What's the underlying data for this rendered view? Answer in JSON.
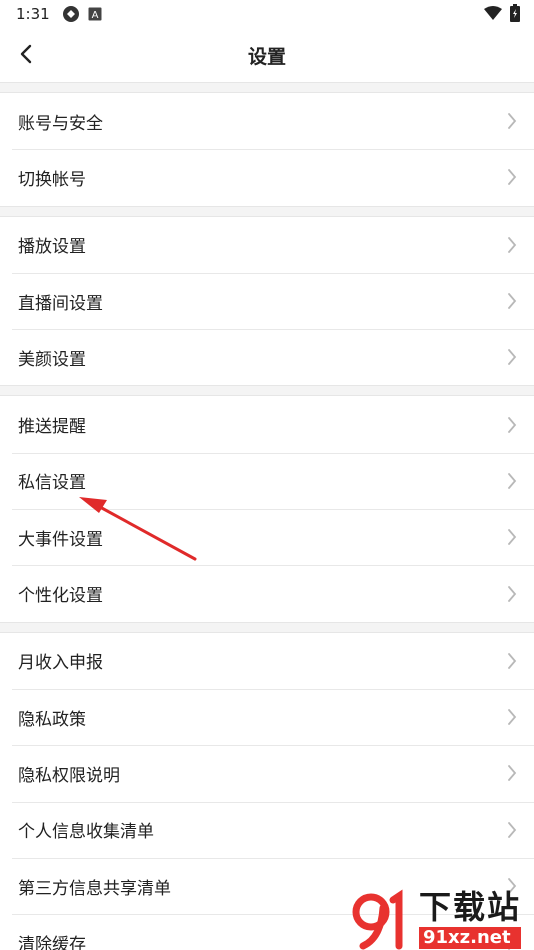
{
  "status_bar": {
    "time": "1:31",
    "icons_left": [
      "sync-icon",
      "a-badge-icon"
    ],
    "icons_right": [
      "wifi-icon",
      "battery-icon"
    ]
  },
  "nav": {
    "title": "设置",
    "back_icon": "chevron-left-icon"
  },
  "groups": [
    {
      "items": [
        "账号与安全",
        "切换帐号"
      ]
    },
    {
      "items": [
        "播放设置",
        "直播间设置",
        "美颜设置"
      ]
    },
    {
      "items": [
        "推送提醒",
        "私信设置",
        "大事件设置",
        "个性化设置"
      ]
    },
    {
      "items": [
        "月收入申报",
        "隐私政策",
        "隐私权限说明",
        "个人信息收集清单",
        "第三方信息共享清单",
        "清除缓存"
      ]
    }
  ],
  "annotation": {
    "color": "#e02a2a",
    "target": "私信设置"
  },
  "watermark": {
    "brand": "91",
    "big": "下载站",
    "small": "91xz.net",
    "accent": "#e8322f"
  },
  "colors": {
    "separator": "#e8e8e8",
    "gap_bg": "#f4f4f4",
    "chevron": "#b8b8b8"
  }
}
